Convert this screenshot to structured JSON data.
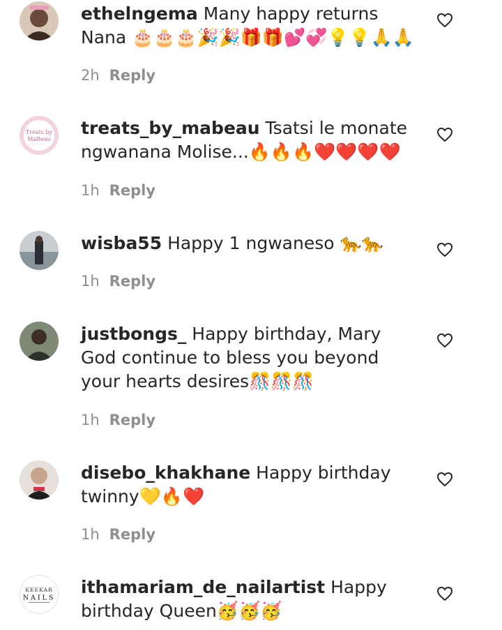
{
  "comments": [
    {
      "username": "ethelngema",
      "text": "Many happy returns Nana",
      "emoji": "🎂🎂🎂🎉🎉🎁🎁💕💞💡💡🙏🙏",
      "time": "2h",
      "reply": "Reply",
      "avatar_color": "#6b4a3a"
    },
    {
      "username": "treats_by_mabeau",
      "text": "Tsatsi le monate ngwanana Molise...",
      "emoji": "🔥🔥🔥❤️❤️❤️❤️",
      "time": "1h",
      "reply": "Reply",
      "avatar_color": "#f2d4dc",
      "avatar_text": "Treats by MaBeau"
    },
    {
      "username": "wisba55",
      "text": "Happy 1 ngwaneso",
      "emoji": "🐆🐆",
      "time": "1h",
      "reply": "Reply",
      "avatar_color": "#7d8a93"
    },
    {
      "username": "justbongs_",
      "text": "Happy birthday, Mary God continue to bless you beyond your hearts desires",
      "emoji": "🎊🎊🎊",
      "time": "1h",
      "reply": "Reply",
      "avatar_color": "#4f5a4a"
    },
    {
      "username": "disebo_khakhane",
      "text": "Happy birthday twinny",
      "emoji": "💛🔥❤️",
      "time": "1h",
      "reply": "Reply",
      "avatar_color": "#c9a48c"
    },
    {
      "username": "ithamariam_de_nailartist",
      "text": "Happy birthday Queen",
      "emoji": "🥳🥳🥳",
      "time": "",
      "reply": "",
      "avatar_color": "#ffffff",
      "avatar_text": "KEEKAR NAILS"
    }
  ]
}
